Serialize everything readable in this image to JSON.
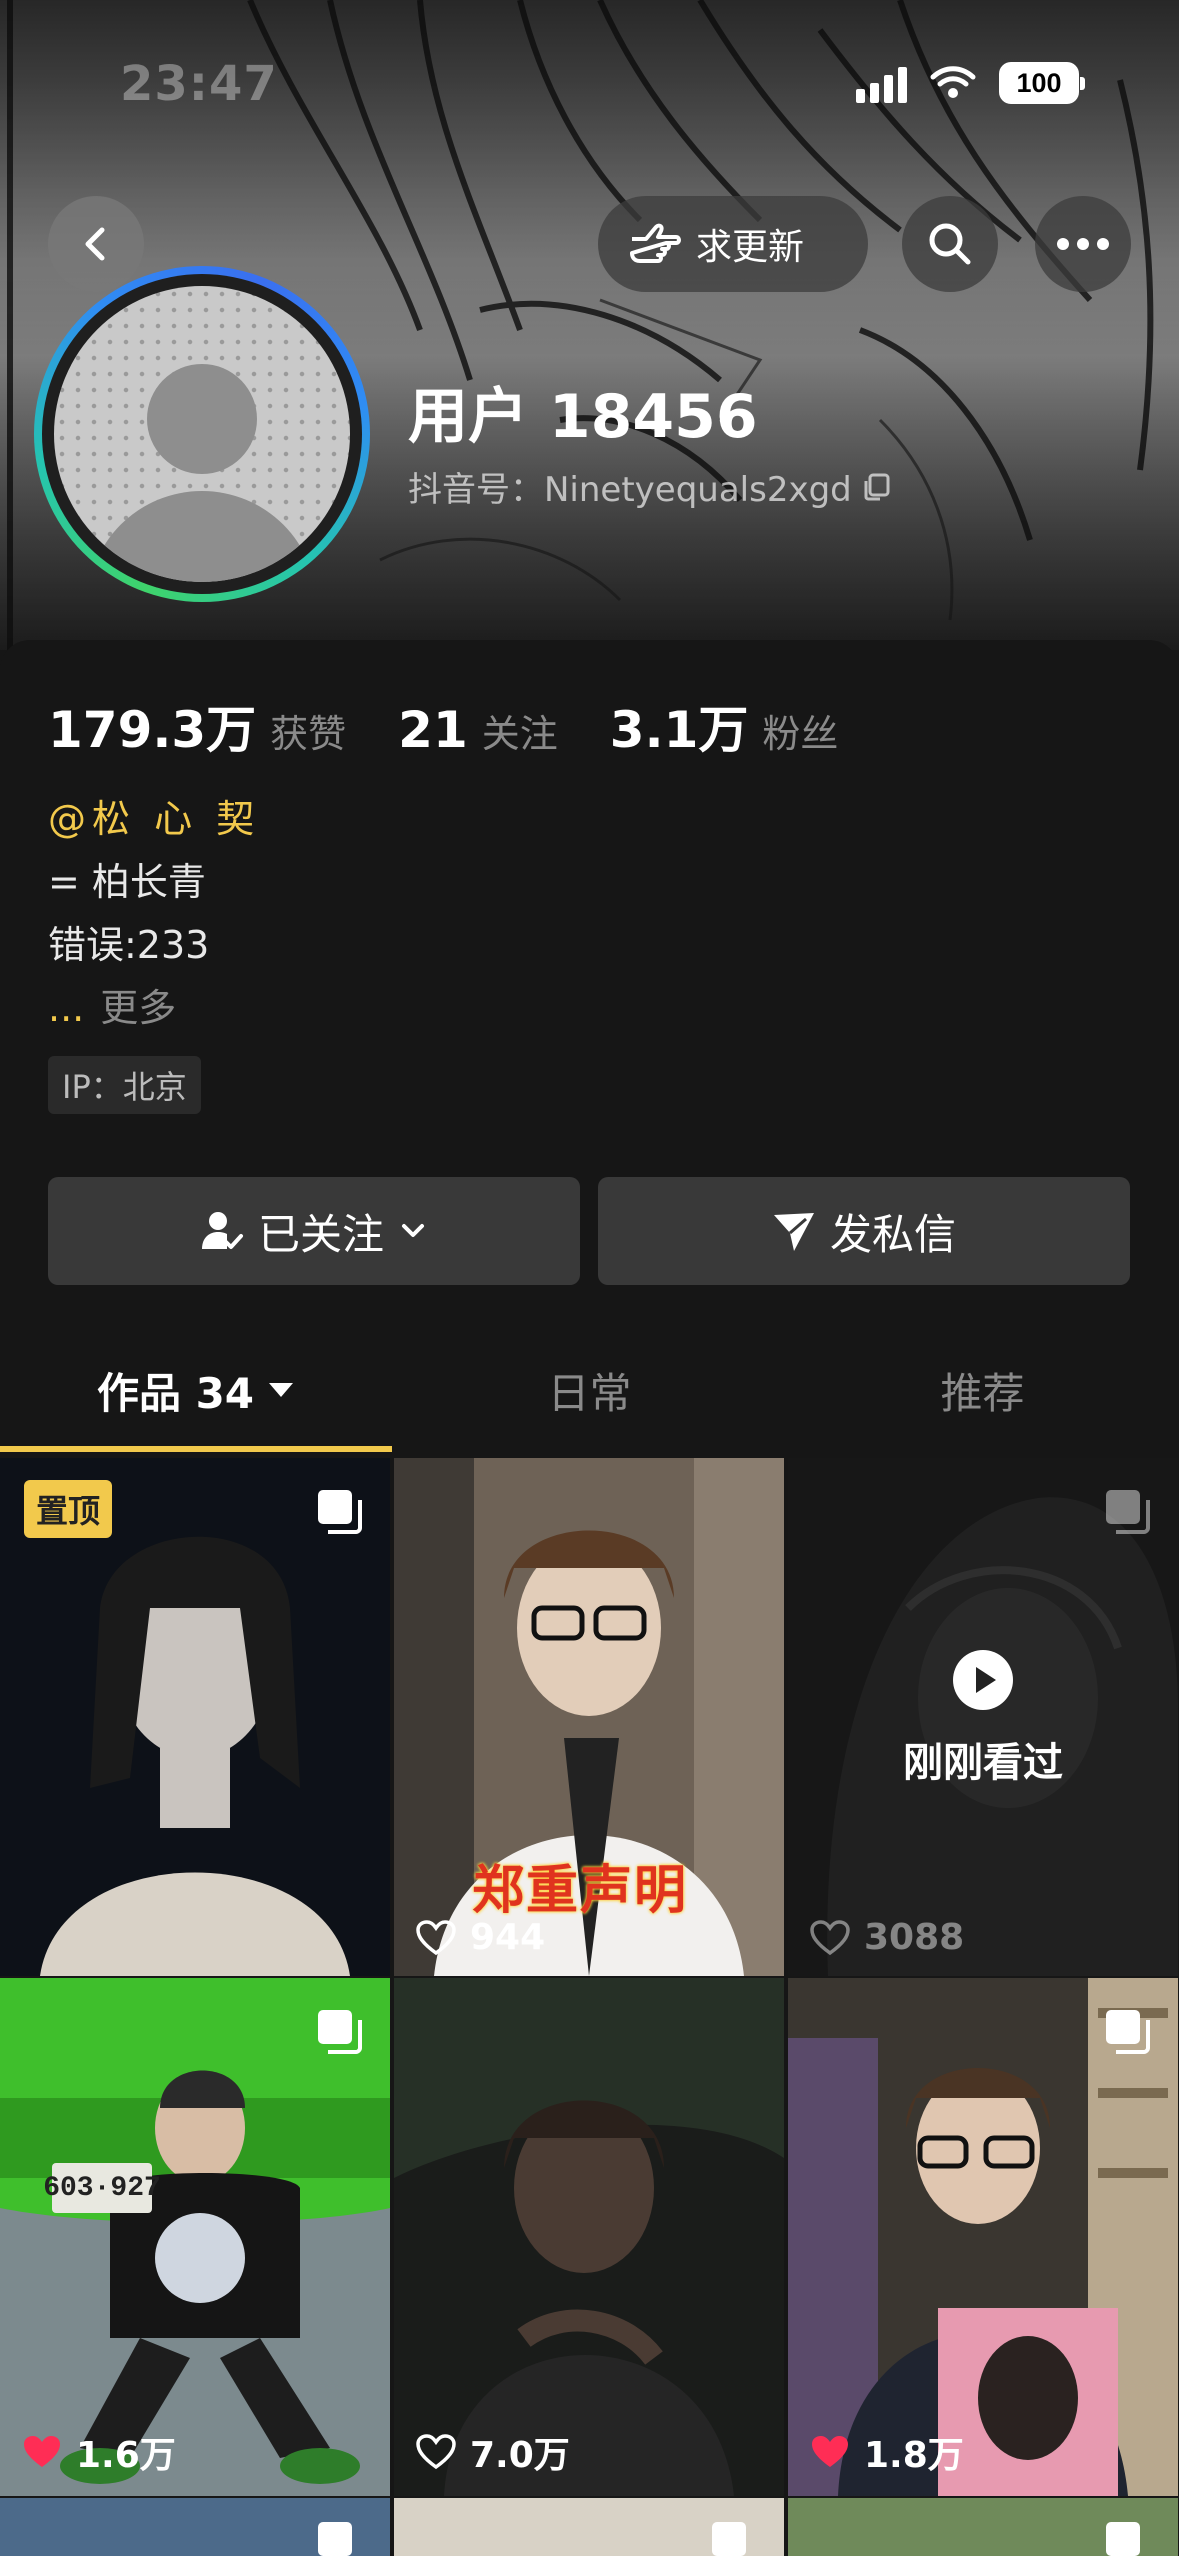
{
  "status_bar": {
    "time": "23:47",
    "battery": "100"
  },
  "header": {
    "update_label": "求更新"
  },
  "profile": {
    "username": "用户 18456",
    "douyin_id": "抖音号：Ninetyequals2xgd"
  },
  "stats": [
    {
      "value": "179.3万",
      "label": "获赞"
    },
    {
      "value": "21",
      "label": "关注"
    },
    {
      "value": "3.1万",
      "label": "粉丝"
    }
  ],
  "bio": {
    "mention": "@松 心 契",
    "line1": "= 柏长青",
    "line2": "错误:233",
    "more_dots": "...",
    "more": "更多"
  },
  "ip_tag": "IP：北京",
  "actions": {
    "follow": "已关注",
    "message": "发私信"
  },
  "tabs": [
    {
      "label": "作品 34"
    },
    {
      "label": "日常"
    },
    {
      "label": "推荐"
    }
  ],
  "grid": {
    "pinned_label": "置顶",
    "watched_label": "刚刚看过",
    "caption": "郑重声明",
    "plate": "603·927",
    "tiles": [
      {
        "likes": ""
      },
      {
        "likes": "944"
      },
      {
        "likes": "3088"
      },
      {
        "likes": "1.6万"
      },
      {
        "likes": "7.0万"
      },
      {
        "likes": "1.8万"
      }
    ]
  },
  "colors": {
    "accent": "#f2c94c",
    "like_red": "#ff2d55",
    "background": "#161616"
  }
}
